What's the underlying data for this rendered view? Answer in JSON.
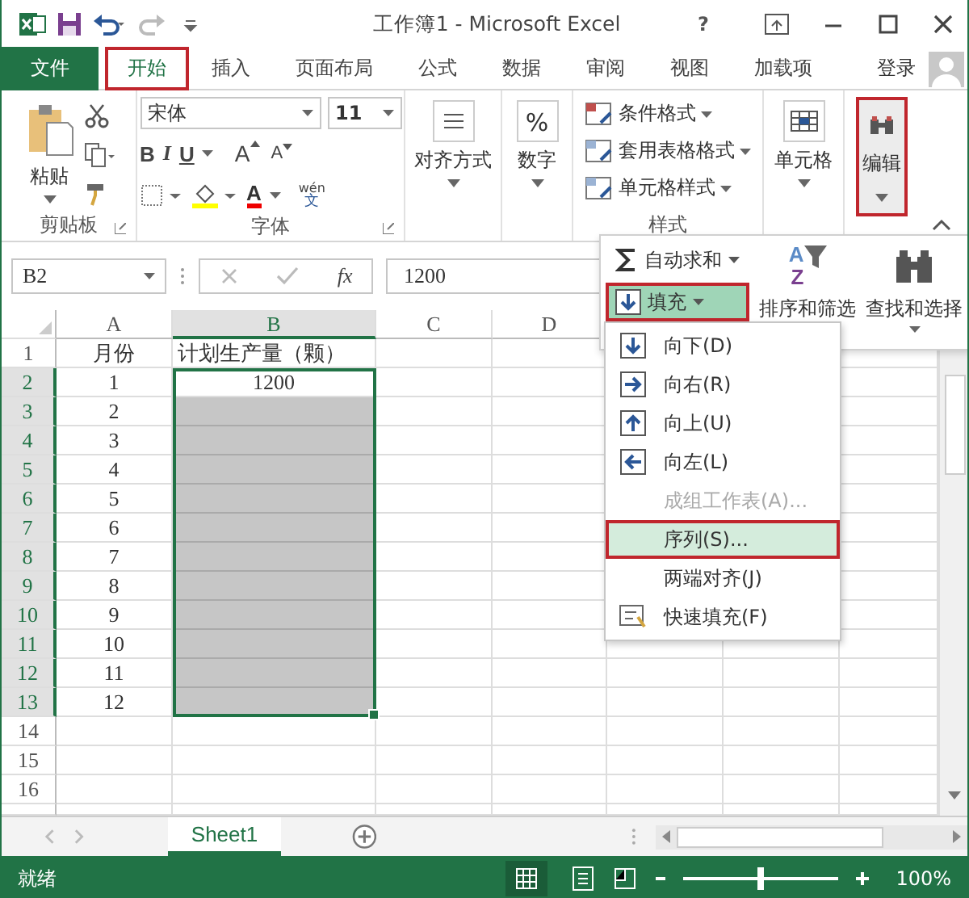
{
  "window": {
    "title": "工作簿1 - Microsoft Excel",
    "help": "?"
  },
  "tabs": [
    {
      "label": "文件",
      "kind": "file",
      "selected": false,
      "highlighted": false
    },
    {
      "label": "开始",
      "kind": "tab",
      "selected": true,
      "highlighted": true
    },
    {
      "label": "插入",
      "kind": "tab",
      "selected": false,
      "highlighted": false
    },
    {
      "label": "页面布局",
      "kind": "tab",
      "selected": false,
      "highlighted": false
    },
    {
      "label": "公式",
      "kind": "tab",
      "selected": false,
      "highlighted": false
    },
    {
      "label": "数据",
      "kind": "tab",
      "selected": false,
      "highlighted": false
    },
    {
      "label": "审阅",
      "kind": "tab",
      "selected": false,
      "highlighted": false
    },
    {
      "label": "视图",
      "kind": "tab",
      "selected": false,
      "highlighted": false
    },
    {
      "label": "加载项",
      "kind": "tab",
      "selected": false,
      "highlighted": false
    }
  ],
  "sign_in": "登录",
  "ribbon": {
    "clipboard": {
      "paste": "粘贴",
      "label": "剪贴板"
    },
    "font": {
      "name": "宋体",
      "size": "11",
      "bold": "B",
      "italic": "I",
      "underline": "U",
      "grow": "A",
      "shrink": "A",
      "font_color": "A",
      "phonetic": "wén",
      "phonetic_char": "文",
      "label": "字体"
    },
    "alignment": {
      "label": "对齐方式"
    },
    "number": {
      "symbol": "%",
      "label": "数字"
    },
    "styles": {
      "items": [
        "条件格式",
        "套用表格格式",
        "单元格样式"
      ],
      "label": "样式"
    },
    "cells": {
      "label": "单元格"
    },
    "editing": {
      "label": "编辑",
      "highlighted": true
    }
  },
  "formula_bar": {
    "name_box": "B2",
    "fx": "fx",
    "value": "1200"
  },
  "sheet": {
    "columns": [
      {
        "label": "A",
        "selected": false
      },
      {
        "label": "B",
        "selected": true
      },
      {
        "label": "C",
        "selected": false
      },
      {
        "label": "D",
        "selected": false
      }
    ],
    "rows": [
      {
        "header": "1",
        "a": "月份",
        "b": "计划生产量（颗）",
        "selected": false
      },
      {
        "header": "2",
        "a": "1",
        "b": "1200",
        "selected": true
      },
      {
        "header": "3",
        "a": "2",
        "selected": true
      },
      {
        "header": "4",
        "a": "3",
        "selected": true
      },
      {
        "header": "5",
        "a": "4",
        "selected": true
      },
      {
        "header": "6",
        "a": "5",
        "selected": true
      },
      {
        "header": "7",
        "a": "6",
        "selected": true
      },
      {
        "header": "8",
        "a": "7",
        "selected": true
      },
      {
        "header": "9",
        "a": "8",
        "selected": true
      },
      {
        "header": "10",
        "a": "9",
        "selected": true
      },
      {
        "header": "11",
        "a": "10",
        "selected": true
      },
      {
        "header": "12",
        "a": "11",
        "selected": true
      },
      {
        "header": "13",
        "a": "12",
        "selected": true
      },
      {
        "header": "14",
        "selected": false
      },
      {
        "header": "15",
        "selected": false
      },
      {
        "header": "16",
        "selected": false
      }
    ]
  },
  "edit_menu": {
    "items": [
      {
        "kind": "sum",
        "label": "自动求和",
        "highlighted": false
      },
      {
        "kind": "fill",
        "label": "填充",
        "highlighted": true
      }
    ],
    "sort": {
      "letters": [
        "A",
        "Z"
      ],
      "label": "排序和筛选"
    },
    "find": {
      "label": "查找和选择"
    }
  },
  "fill_menu": [
    {
      "kind": "down",
      "label": "向下(D)",
      "disabled": false,
      "highlighted": false
    },
    {
      "kind": "right",
      "label": "向右(R)",
      "disabled": false,
      "highlighted": false
    },
    {
      "kind": "up",
      "label": "向上(U)",
      "disabled": false,
      "highlighted": false
    },
    {
      "kind": "left",
      "label": "向左(L)",
      "disabled": false,
      "highlighted": false
    },
    {
      "kind": "plain",
      "label": "成组工作表(A)...",
      "disabled": true,
      "highlighted": false
    },
    {
      "kind": "plain",
      "label": "序列(S)...",
      "disabled": false,
      "highlighted": true
    },
    {
      "kind": "plain",
      "label": "两端对齐(J)",
      "disabled": false,
      "highlighted": false
    },
    {
      "kind": "flash",
      "label": "快速填充(F)",
      "disabled": false,
      "highlighted": false
    }
  ],
  "sheet_tabs": [
    {
      "label": "Sheet1",
      "selected": true
    }
  ],
  "status": {
    "text": "就绪",
    "zoom": "100%",
    "level": 0.5
  }
}
